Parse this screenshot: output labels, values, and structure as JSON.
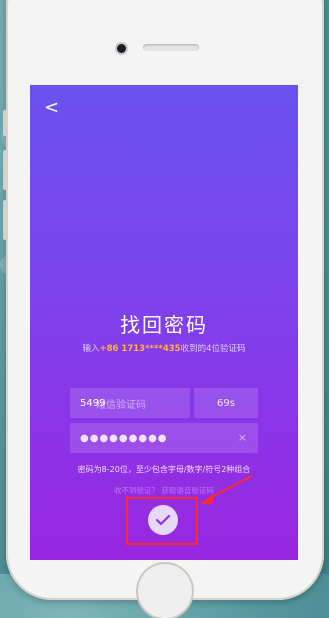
{
  "screen": {
    "back_glyph": "<",
    "title": "找回密码",
    "subtitle_prefix": "输入",
    "phone_number": "+86 1713****435",
    "subtitle_suffix": "收到的4位验证码",
    "code_value": "5499",
    "code_placeholder": "短信验证码",
    "timer": "69s",
    "password_masked": "●●●●●●●●●",
    "clear_glyph": "×",
    "rule_text": "密码为8-20位，至少包含字母/数字/符号2种组合",
    "voice_hint": "收不到验证？ 获取语音验证码",
    "submit_icon": "checkmark-icon"
  },
  "colors": {
    "gradient_top": "#6952ee",
    "gradient_bottom": "#9927df",
    "phone_highlight": "#ffb23c",
    "annotation_red": "#ff2a2a"
  }
}
